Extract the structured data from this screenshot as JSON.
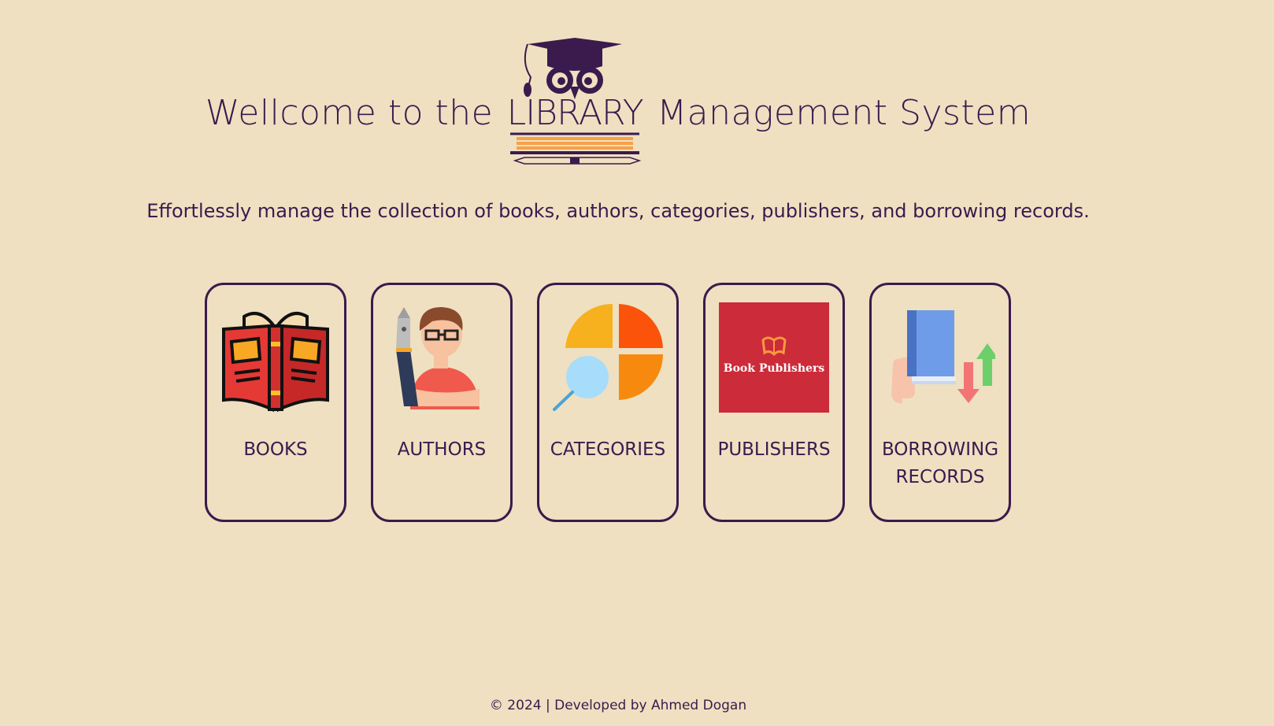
{
  "hero": {
    "before": "Wellcome to the",
    "logo_word": "LIBRARY",
    "after": "Management System"
  },
  "subtitle": "Effortlessly manage the collection of books, authors, categories, publishers, and borrowing records.",
  "cards": [
    {
      "label": "BOOKS",
      "icon": "open-book-icon"
    },
    {
      "label": "AUTHORS",
      "icon": "author-with-pen-icon"
    },
    {
      "label": "CATEGORIES",
      "icon": "categories-magnifier-icon"
    },
    {
      "label": "PUBLISHERS",
      "icon": "book-publishers-icon",
      "image_text": "Book Publishers"
    },
    {
      "label": "BORROWING RECORDS",
      "icon": "borrowing-book-arrows-icon"
    }
  ],
  "footer": "© 2024 | Developed by Ahmed Dogan",
  "colors": {
    "background": "#efe0c1",
    "primary": "#3b1a4d",
    "publisher_red": "#cc2b3a",
    "book_red": "#e53935"
  }
}
